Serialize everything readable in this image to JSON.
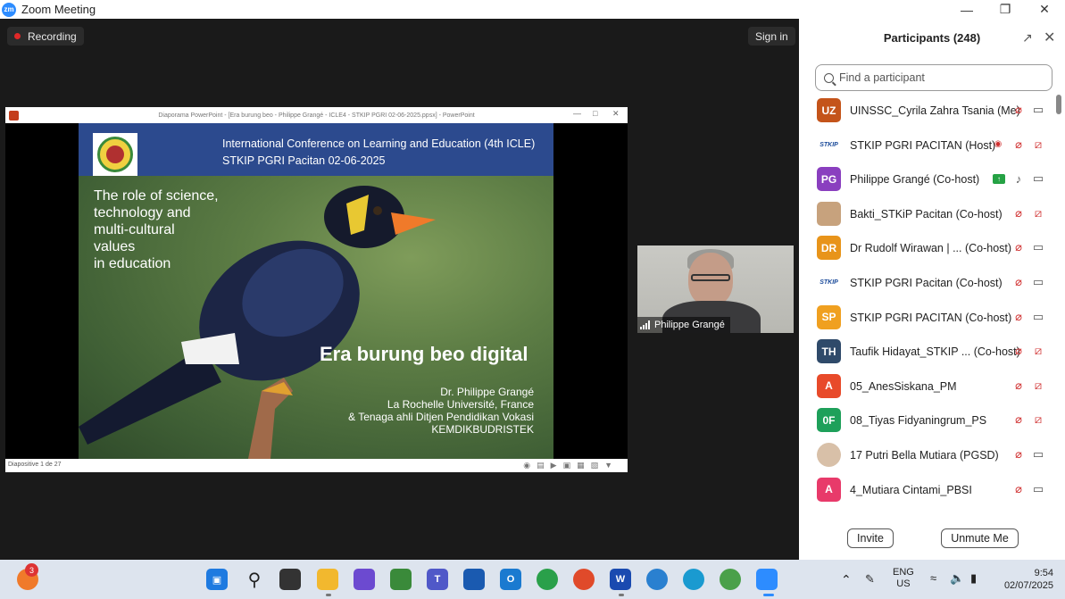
{
  "window": {
    "title": "Zoom Meeting",
    "logo_text": "zm"
  },
  "meeting": {
    "recording_label": "Recording",
    "signin_label": "Sign in"
  },
  "ppt": {
    "window_title": "Diaporama PowerPoint - [Era burung beo - Philippe Grangé - ICLE4 - STKIP PGRI 02-06-2025.ppsx] - PowerPoint",
    "status_text": "Diapositive 1 de 27",
    "slide": {
      "header_line1": "International Conference on Learning and Education (4th ICLE)",
      "header_line2": "STKIP PGRI Pacitan 02-06-2025",
      "role_lines": [
        "The role of science,",
        "technology and",
        "multi-cultural",
        "values",
        "in education"
      ],
      "main_title": "Era burung beo digital",
      "author_lines": [
        "Dr. Philippe Grangé",
        "La Rochelle Université, France",
        "& Tenaga ahli Ditjen Pendidikan Vokasi",
        "KEMDIKBUDRISTEK"
      ]
    }
  },
  "speaker": {
    "name": "Philippe Grangé"
  },
  "participants": {
    "title": "Participants (248)",
    "search_placeholder": "Find a participant",
    "list": [
      {
        "initials": "UZ",
        "avatar_color": "#c4541a",
        "name": "UINSSC_Cyrila Zahra Tsania (Me)",
        "mic": "muted",
        "cam": "on"
      },
      {
        "initials": "STKIP",
        "avatar_type": "stkip",
        "name": "STKIP PGRI PACITAN (Host)",
        "mic": "muted",
        "cam": "off",
        "recording": true
      },
      {
        "initials": "PG",
        "avatar_color": "#8a3fbf",
        "name": "Philippe Grangé (Co-host)",
        "mic": "on",
        "cam": "on",
        "sharing": true
      },
      {
        "initials": "",
        "avatar_type": "person",
        "name": "Bakti_STKiP Pacitan (Co-host)",
        "mic": "muted",
        "cam": "off"
      },
      {
        "initials": "DR",
        "avatar_color": "#e8941a",
        "name": "Dr Rudolf Wirawan | ... (Co-host)",
        "mic": "muted",
        "cam": "on"
      },
      {
        "initials": "STKIP",
        "avatar_type": "stkip",
        "name": "STKIP PGRI Pacitan (Co-host)",
        "mic": "muted",
        "cam": "on"
      },
      {
        "initials": "SP",
        "avatar_color": "#f0a020",
        "name": "STKIP PGRI PACITAN (Co-host)",
        "mic": "muted",
        "cam": "on"
      },
      {
        "initials": "TH",
        "avatar_color": "#2f4a6a",
        "name": "Taufik Hidayat_STKIP ... (Co-host)",
        "mic": "muted",
        "cam": "off"
      },
      {
        "initials": "A",
        "avatar_color": "#e84a2a",
        "name": "05_AnesSiskana_PM",
        "mic": "muted",
        "cam": "off"
      },
      {
        "initials": "0F",
        "avatar_color": "#1ea05a",
        "name": "08_Tiyas Fidyaningrum_PS",
        "mic": "muted",
        "cam": "off"
      },
      {
        "initials": "",
        "avatar_type": "girl",
        "name": "17 Putri Bella Mutiara (PGSD)",
        "mic": "muted",
        "cam": "on"
      },
      {
        "initials": "A",
        "avatar_color": "#e83a6a",
        "name": "4_Mutiara Cintami_PBSI",
        "mic": "muted",
        "cam": "on"
      }
    ],
    "invite_label": "Invite",
    "unmute_label": "Unmute Me"
  },
  "taskbar": {
    "notification_count": "3",
    "language_line1": "ENG",
    "language_line2": "US",
    "time": "9:54",
    "date": "02/07/2025"
  }
}
